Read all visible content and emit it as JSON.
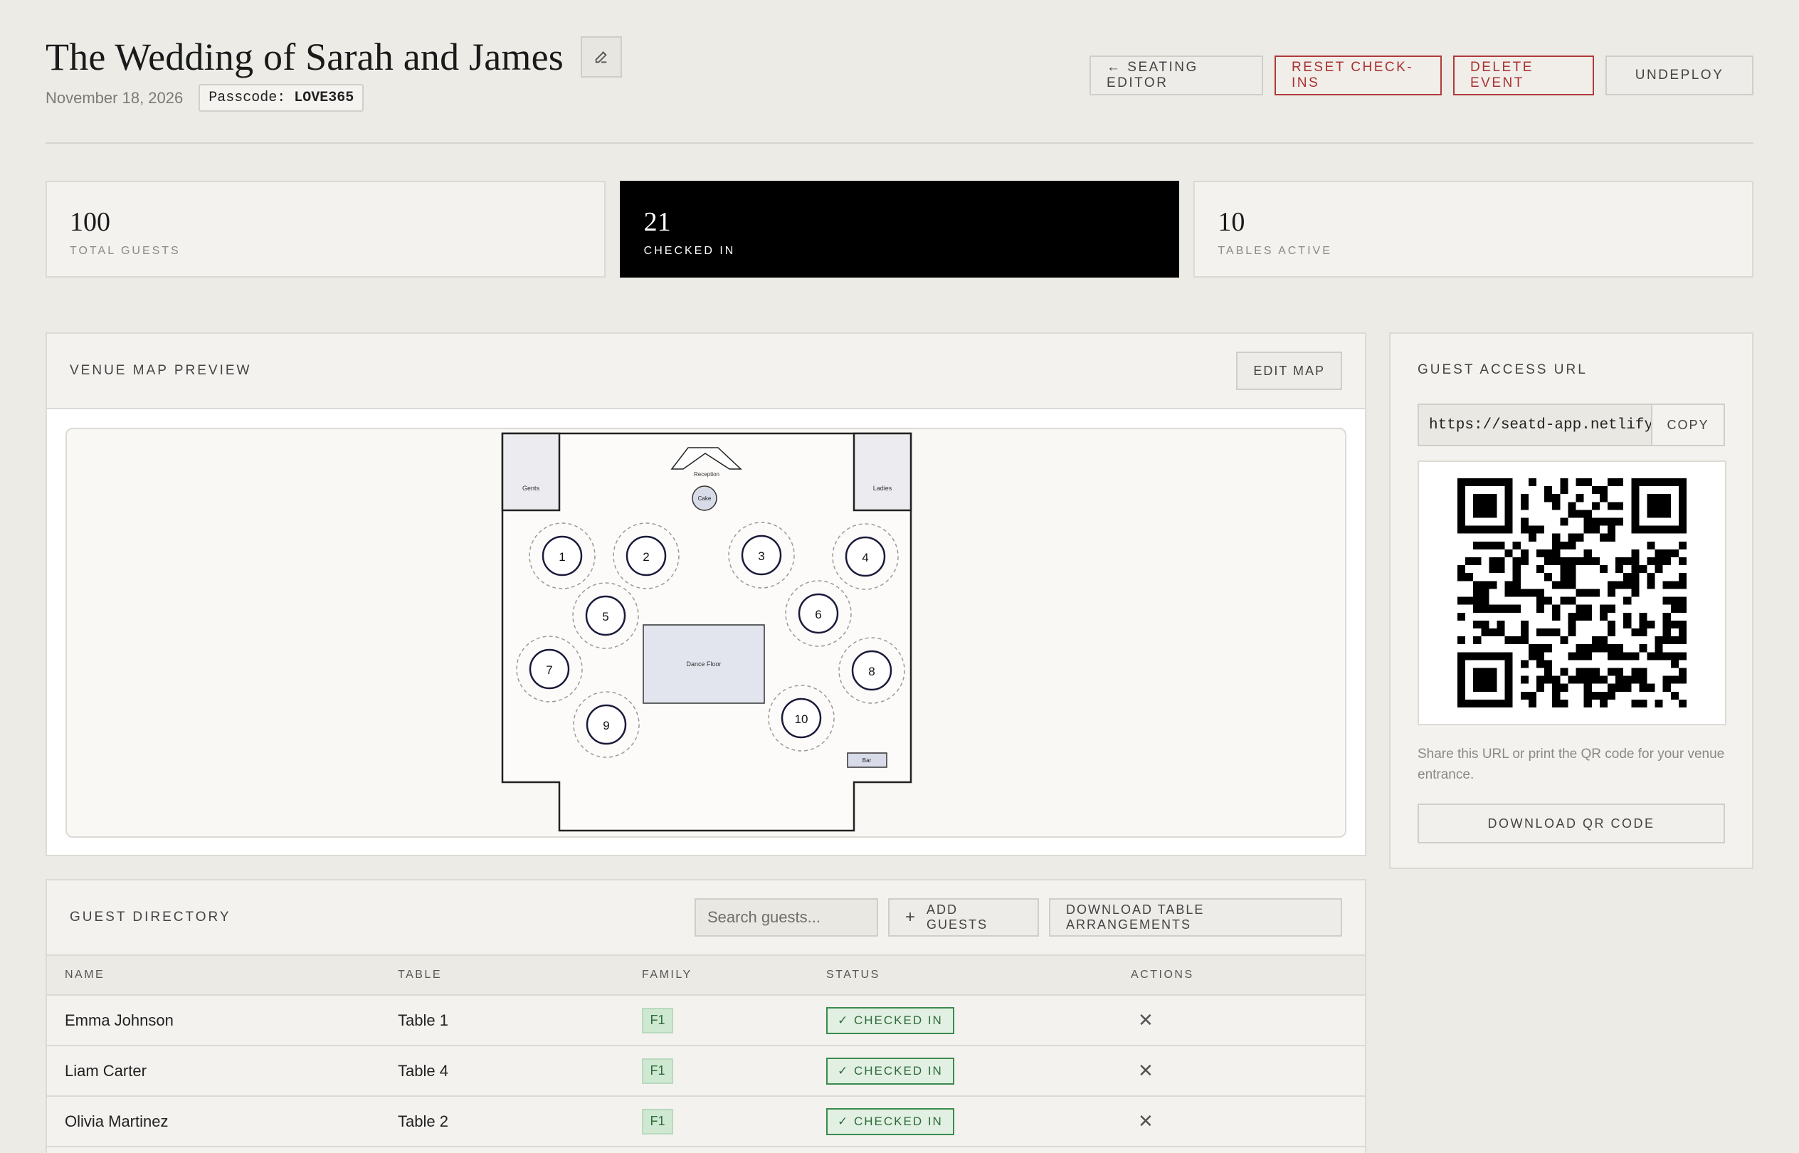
{
  "header": {
    "title": "The Wedding of Sarah and James",
    "date": "November 18, 2026",
    "passcode_label": "Passcode:",
    "passcode_value": "LOVE365",
    "actions": {
      "seating_editor": "← SEATING EDITOR",
      "reset_checkins": "RESET CHECK-INS",
      "delete_event": "DELETE EVENT",
      "undeploy": "UNDEPLOY"
    },
    "colors": {
      "danger": "#a83232"
    }
  },
  "stats": [
    {
      "value": "100",
      "label": "TOTAL GUESTS"
    },
    {
      "value": "21",
      "label": "CHECKED IN"
    },
    {
      "value": "10",
      "label": "TABLES ACTIVE"
    }
  ],
  "venue": {
    "title": "VENUE MAP PREVIEW",
    "edit_label": "EDIT MAP",
    "labels": {
      "gents": "Gents",
      "ladies": "Ladies",
      "reception": "Reception",
      "cake": "Cake",
      "dance_floor": "Dance Floor",
      "bar": "Bar"
    },
    "tables": [
      "1",
      "2",
      "3",
      "4",
      "5",
      "6",
      "7",
      "8",
      "9",
      "10"
    ]
  },
  "guests": {
    "title": "GUEST DIRECTORY",
    "search_placeholder": "Search guests...",
    "add_label": "ADD GUESTS",
    "download_label": "DOWNLOAD TABLE ARRANGEMENTS",
    "columns": {
      "name": "NAME",
      "table": "TABLE",
      "family": "FAMILY",
      "status": "STATUS",
      "actions": "ACTIONS"
    },
    "rows": [
      {
        "name": "Emma Johnson",
        "table": "Table 1",
        "family": "F1",
        "status": "✓ CHECKED IN"
      },
      {
        "name": "Liam Carter",
        "table": "Table 4",
        "family": "F1",
        "status": "✓ CHECKED IN"
      },
      {
        "name": "Olivia Martinez",
        "table": "Table 2",
        "family": "F1",
        "status": "✓ CHECKED IN"
      }
    ]
  },
  "access": {
    "title": "GUEST ACCESS URL",
    "url": "https://seatd-app.netlify.",
    "copy_label": "COPY",
    "help": "Share this URL or print the QR code for your venue entrance.",
    "download_qr": "DOWNLOAD QR CODE"
  }
}
